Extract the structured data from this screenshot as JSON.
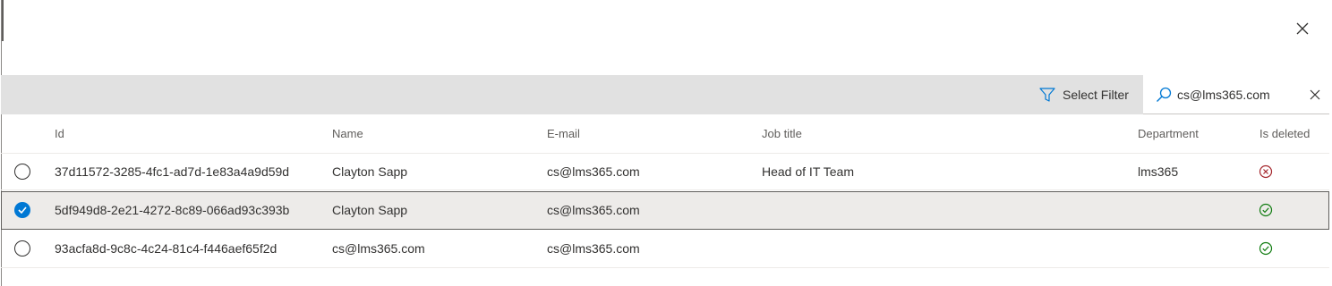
{
  "panel": {
    "close_icon": "close-icon"
  },
  "toolbar": {
    "filter_label": "Select Filter",
    "filter_icon": "filter-icon"
  },
  "search": {
    "value": "cs@lms365.com",
    "search_icon": "search-icon",
    "clear_icon": "clear-icon"
  },
  "columns": {
    "id": "Id",
    "name": "Name",
    "email": "E-mail",
    "job_title": "Job title",
    "department": "Department",
    "is_deleted": "Is deleted"
  },
  "rows": [
    {
      "id": "37d11572-3285-4fc1-ad7d-1e83a4a9d59d",
      "name": "Clayton Sapp",
      "email": "cs@lms365.com",
      "job_title": "Head of IT Team",
      "department": "lms365",
      "is_deleted": "error-circle-icon",
      "selected": false
    },
    {
      "id": "5df949d8-2e21-4272-8c89-066ad93c393b",
      "name": "Clayton Sapp",
      "email": "cs@lms365.com",
      "job_title": "",
      "department": "",
      "is_deleted": "check-circle-icon",
      "selected": true
    },
    {
      "id": "93acfa8d-9c8c-4c24-81c4-f446aef65f2d",
      "name": "cs@lms365.com",
      "email": "cs@lms365.com",
      "job_title": "",
      "department": "",
      "is_deleted": "check-circle-icon",
      "selected": false
    }
  ],
  "colors": {
    "toolbar_bg": "#e1e1e1",
    "accent": "#0078d4",
    "error": "#a4262c",
    "success": "#107c10",
    "selected_row_bg": "#edebe9"
  }
}
